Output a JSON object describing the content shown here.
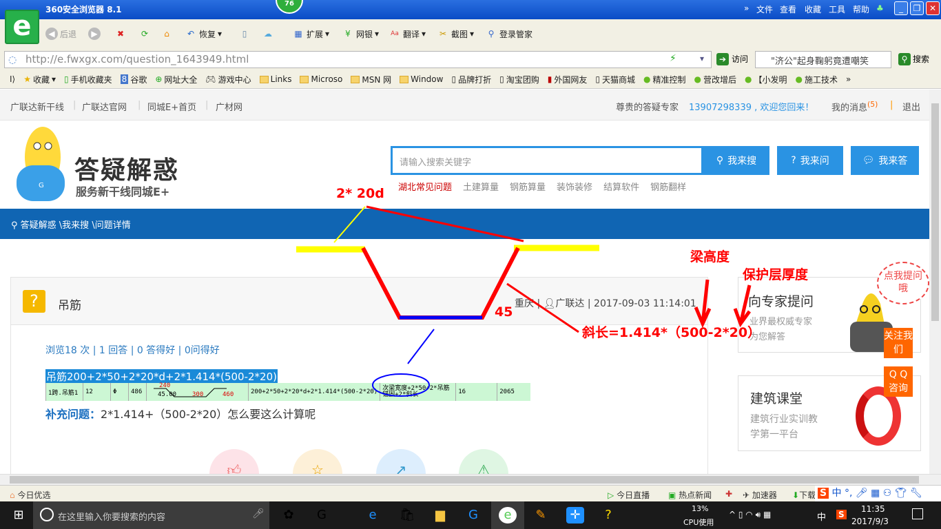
{
  "browser": {
    "title": "360安全浏览器 8.1",
    "badge": "76",
    "menus": [
      "文件",
      "查看",
      "收藏",
      "工具",
      "帮助"
    ],
    "toolbar": {
      "back": "后退",
      "restore": "恢复",
      "extend": "扩展",
      "bank": "网银",
      "translate": "翻译",
      "screenshot": "截图",
      "login": "登录管家"
    },
    "url": "http://e.fwxgx.com/question_1643949.html",
    "go": "访问",
    "search_box": "\"济公\"起身鞠躬竟遭嘲笑",
    "search_btn": "搜索",
    "bookmarks": [
      "收藏",
      "手机收藏夹",
      "谷歌",
      "网址大全",
      "游戏中心",
      "Links",
      "Microso",
      "MSN 网",
      "Window",
      "品牌打折",
      "淘宝团购",
      "外国网友",
      "天猫商城",
      "精准控制",
      "营改增后",
      "【小发明",
      "施工技术"
    ],
    "status": {
      "left": "今日优选",
      "items": [
        "今日直播",
        "热点新闻",
        "加速器",
        "下载"
      ]
    }
  },
  "site": {
    "topnav": [
      "广联达新干线",
      "广联达官网",
      "同城E+首页",
      "广材网"
    ],
    "greeting": "尊贵的答疑专家",
    "user": "13907298339 , 欢迎您回来！",
    "messages": "我的消息",
    "msg_count": "(5)",
    "logout": "退出",
    "logo_title": "答疑解惑",
    "logo_sub": "服务新干线同城E+",
    "search_placeholder": "请输入搜索关键字",
    "btn_search": "我来搜",
    "btn_ask": "我来问",
    "btn_answer": "我来答",
    "hot": [
      "湖北常见问题",
      "土建算量",
      "钢筋算量",
      "装饰装修",
      "结算软件",
      "钢筋翻样"
    ],
    "breadcrumb": "答疑解惑 \\我来搜 \\问题详情"
  },
  "question": {
    "title": "吊筋",
    "meta_loc": "重庆",
    "meta_user": "广联达",
    "meta_time": "2017-09-03 11:14:01",
    "stats": "浏览18 次 | 1 回答 | 0 答得好 | 0问得好",
    "formula": "吊筋200+2*50+2*20*d+2*1.414*(500-2*20)",
    "row": [
      "1跨.吊筋1",
      "12",
      "Φ",
      "486",
      "200+2*50+2*20*d+2*1.414*(500-2*20)",
      "次梁宽度+2*50+2*吊筋锚固+2*斜长",
      "16",
      "2065"
    ],
    "shape": {
      "top": "240",
      "angle": "45.00",
      "bottom": "300",
      "right": "460"
    },
    "supp_label": "补充问题：",
    "supp_text": "2*1.414+（500-2*20）怎么要这么计算呢"
  },
  "sidebar": {
    "expert_title": "向专家提问",
    "expert_sub1": "业界最权威专家",
    "expert_sub2": "为您解答",
    "bubble": "点我提问哦",
    "follow": "关注我们",
    "qq": "Q Q 咨询",
    "class_title": "建筑课堂",
    "class_sub1": "建筑行业实训教",
    "class_sub2": "学第一平台"
  },
  "annotations": {
    "a1": "2* 20d",
    "a2": "45",
    "a3": "梁高度",
    "a4": "保护层厚度",
    "a5": "斜长=1.414*（500-2*20）"
  },
  "taskbar": {
    "search": "在这里输入你要搜索的内容",
    "cpu": "13%",
    "cpu_label": "CPU使用",
    "ime": "中",
    "time": "11:35",
    "date": "2017/9/3"
  }
}
